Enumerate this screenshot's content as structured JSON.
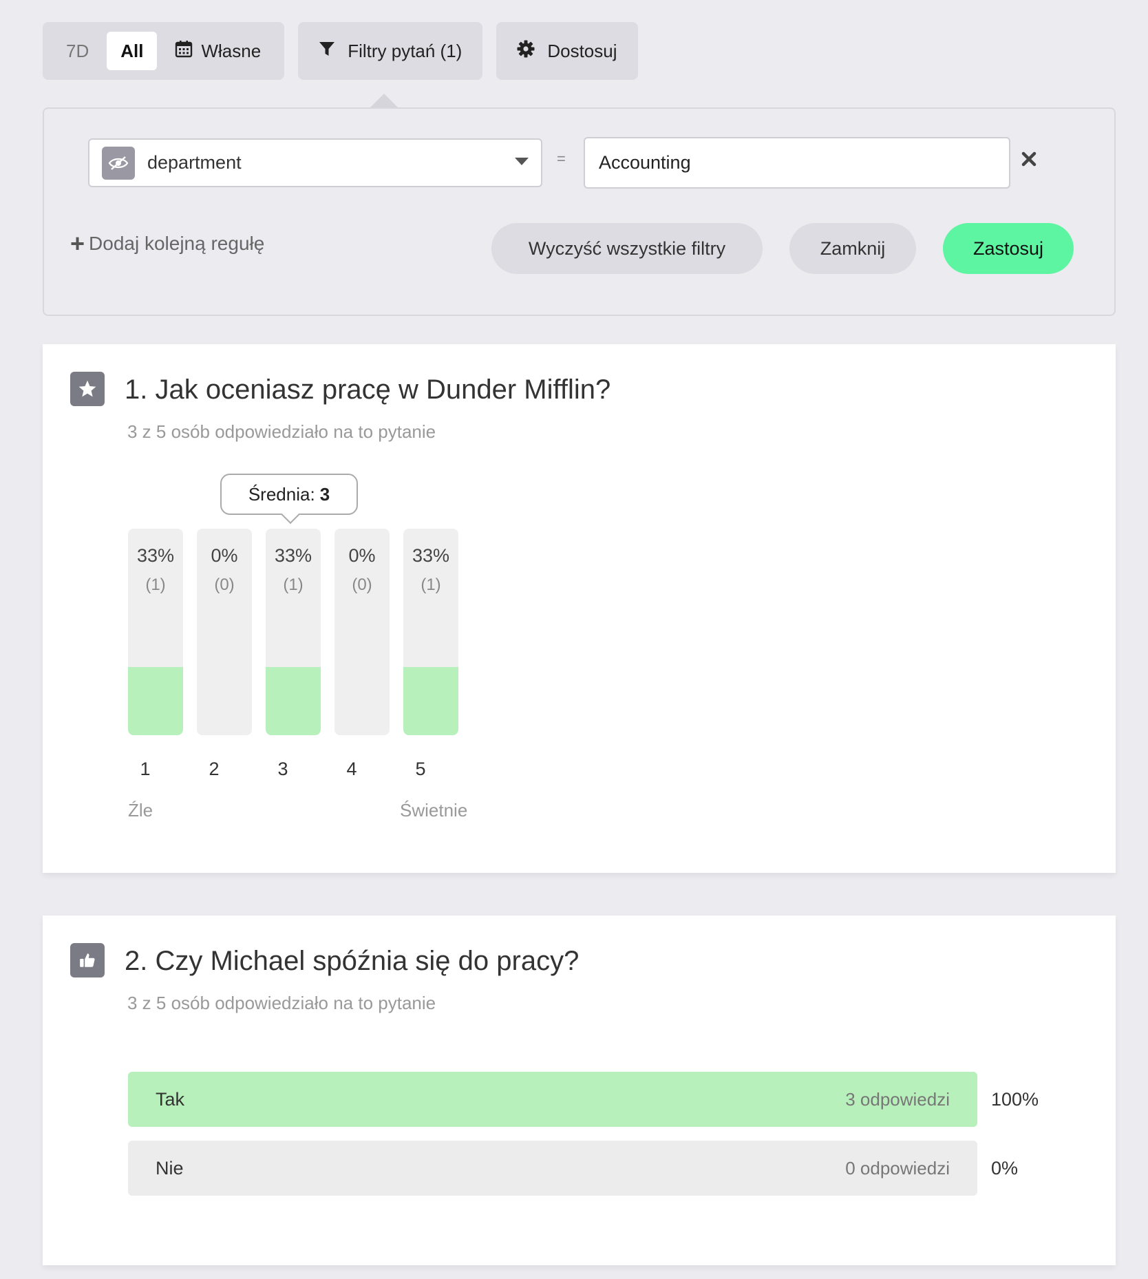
{
  "toolbar": {
    "period_7d": "7D",
    "period_all": "All",
    "period_custom": "Własne",
    "filters_label": "Filtry pytań (1)",
    "customize_label": "Dostosuj"
  },
  "filter": {
    "field": "department",
    "operator": "=",
    "value": "Accounting",
    "add_rule": "Dodaj kolejną regułę",
    "clear_all": "Wyczyść wszystkie filtry",
    "close": "Zamknij",
    "apply": "Zastosuj"
  },
  "questions": [
    {
      "title": "1. Jak oceniasz pracę w Dunder Mifflin?",
      "subtitle": "3 z 5 osób odpowiedziało na to pytanie",
      "average_label": "Średnia:",
      "average_value": "3",
      "low_label": "Źle",
      "high_label": "Świetnie"
    },
    {
      "title": "2. Czy Michael spóźnia się do pracy?",
      "subtitle": "3 z 5 osób odpowiedziało na to pytanie"
    }
  ],
  "chart_data": [
    {
      "type": "bar",
      "categories": [
        "1",
        "2",
        "3",
        "4",
        "5"
      ],
      "values": [
        33,
        0,
        33,
        0,
        33
      ],
      "labels": [
        "33%",
        "0%",
        "33%",
        "0%",
        "33%"
      ],
      "counts": [
        "(1)",
        "(0)",
        "(1)",
        "(0)",
        "(1)"
      ],
      "ylim": [
        0,
        100
      ]
    },
    {
      "type": "bar",
      "orientation": "horizontal",
      "categories": [
        "Tak",
        "Nie"
      ],
      "values": [
        100,
        0
      ],
      "counts": [
        "3 odpowiedzi",
        "0 odpowiedzi"
      ],
      "labels": [
        "100%",
        "0%"
      ],
      "ylim": [
        0,
        100
      ]
    }
  ],
  "colors": {
    "accent": "#5ef5a2",
    "bar_fill": "#b8f0bb",
    "bar_track": "#efefef",
    "background": "#ecebf0"
  }
}
